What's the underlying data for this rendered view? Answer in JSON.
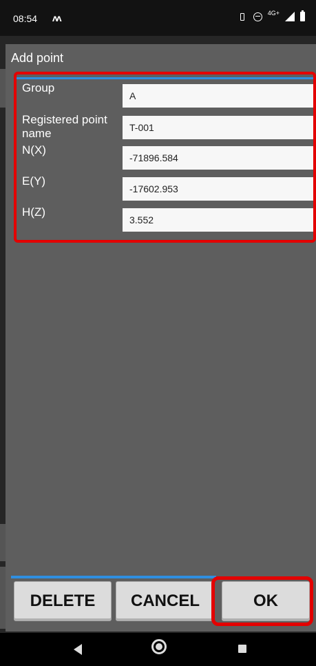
{
  "status_bar": {
    "time": "08:54",
    "carrier_icon": "carrier-m-icon",
    "network_label": "4G+",
    "icons": [
      "vibrate-icon",
      "dnd-icon",
      "signal-icon",
      "battery-icon"
    ]
  },
  "dialog": {
    "title": "Add point",
    "fields": [
      {
        "label": "Group",
        "value": "A"
      },
      {
        "label": "Registered point name",
        "value": "T-001"
      },
      {
        "label": "N(X)",
        "value": "-71896.584"
      },
      {
        "label": "E(Y)",
        "value": "-17602.953"
      },
      {
        "label": "H(Z)",
        "value": "3.552"
      }
    ],
    "buttons": {
      "delete": "DELETE",
      "cancel": "CANCEL",
      "ok": "OK"
    }
  },
  "colors": {
    "highlight": "#e30000",
    "accent_blue": "#2f8fe0",
    "dialog_bg": "#5e5e5e"
  },
  "nav_bar": {
    "icons": [
      "back-icon",
      "home-icon",
      "recents-icon"
    ]
  }
}
